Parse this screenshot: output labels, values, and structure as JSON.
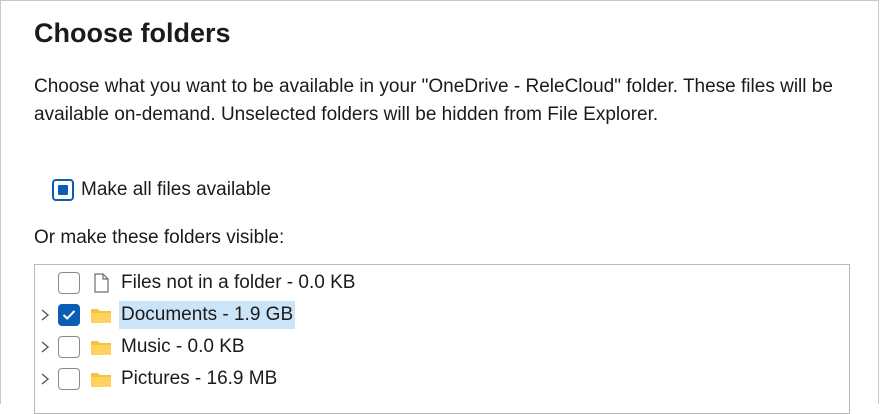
{
  "dialog": {
    "title": "Choose folders",
    "description": "Choose what you want to be available in your \"OneDrive - ReleCloud\" folder. These files will be available on-demand. Unselected folders will be hidden from File Explorer.",
    "make_all_label": "Make all files available",
    "make_all_state": "indeterminate",
    "folders_heading": "Or make these folders visible:"
  },
  "folders": [
    {
      "label": "Files not in a folder - 0.0 KB",
      "icon": "file-icon",
      "checked": false,
      "expandable": false,
      "selected": false
    },
    {
      "label": "Documents - 1.9 GB",
      "icon": "folder-icon",
      "checked": true,
      "expandable": true,
      "selected": true
    },
    {
      "label": "Music - 0.0 KB",
      "icon": "folder-icon",
      "checked": false,
      "expandable": true,
      "selected": false
    },
    {
      "label": "Pictures - 16.9 MB",
      "icon": "folder-icon",
      "checked": false,
      "expandable": true,
      "selected": false
    }
  ],
  "colors": {
    "accent": "#0a5eb5",
    "selection": "#cce4f7",
    "folder": "#f5c342"
  }
}
